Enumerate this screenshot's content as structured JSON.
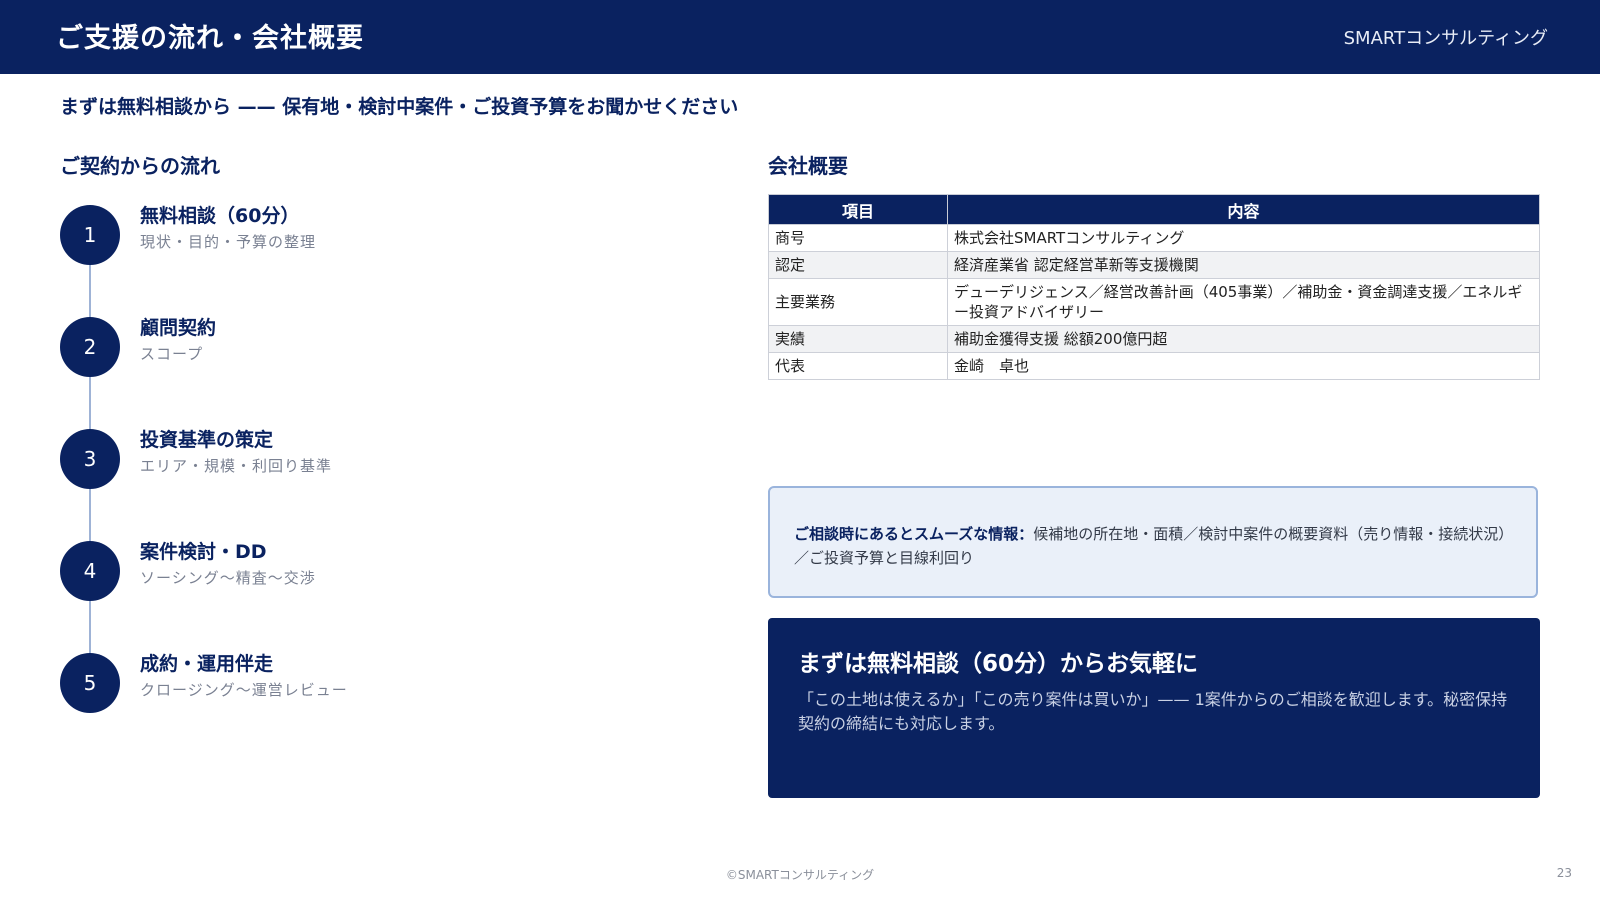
{
  "header": {
    "title": "ご支援の流れ・会社概要",
    "brand": "SMARTコンサルティング"
  },
  "subtitle": "まずは無料相談から —— 保有地・検討中案件・ご投資予算をお聞かせください",
  "flow": {
    "title": "ご契約からの流れ",
    "steps": [
      {
        "num": "1",
        "title": "無料相談（60分）",
        "desc": "現状・目的・予算の整理"
      },
      {
        "num": "2",
        "title": "顧問契約",
        "desc": "スコープ"
      },
      {
        "num": "3",
        "title": "投資基準の策定",
        "desc": "エリア・規模・利回り基準"
      },
      {
        "num": "4",
        "title": "案件検討・DD",
        "desc": "ソーシング〜精査〜交渉"
      },
      {
        "num": "5",
        "title": "成約・運用伴走",
        "desc": "クロージング〜運営レビュー"
      }
    ]
  },
  "overview": {
    "title": "会社概要",
    "headers": [
      "項目",
      "内容"
    ],
    "rows": [
      {
        "key": "商号",
        "value": "株式会社SMARTコンサルティング"
      },
      {
        "key": "認定",
        "value": "経済産業省 認定経営革新等支援機関"
      },
      {
        "key": "主要業務",
        "value": "デューデリジェンス／経営改善計画（405事業）／補助金・資金調達支援／エネルギー投資アドバイザリー"
      },
      {
        "key": "実績",
        "value": "補助金獲得支援 総額200億円超"
      },
      {
        "key": "代表",
        "value": "金崎　卓也"
      }
    ]
  },
  "info": {
    "label": "ご相談時にあるとスムーズな情報：",
    "text": "候補地の所在地・面積／検討中案件の概要資料（売り情報・接続状況）／ご投資予算と目線利回り"
  },
  "cta": {
    "title": "まずは無料相談（60分）からお気軽に",
    "body": "「この土地は使えるか」「この売り案件は買いか」—— 1案件からのご相談を歓迎します。秘密保持契約の締結にも対応します。"
  },
  "footer": {
    "copyright": "©SMARTコンサルティング",
    "page": "23"
  },
  "colors": {
    "navy": "#0a2260",
    "info_bg": "#eaf0f9",
    "info_border": "#9ab4dc",
    "step_line": "#9fb3d6"
  }
}
